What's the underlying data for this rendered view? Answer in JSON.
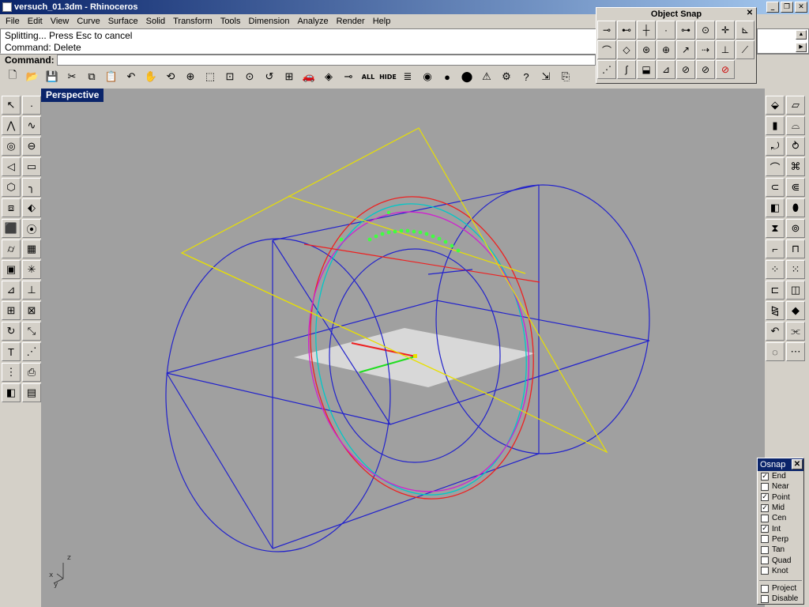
{
  "window": {
    "title": "versuch_01.3dm - Rhinoceros",
    "buttons": {
      "minimize": "_",
      "restore": "❐",
      "close": "✕"
    }
  },
  "menu": [
    "File",
    "Edit",
    "View",
    "Curve",
    "Surface",
    "Solid",
    "Transform",
    "Tools",
    "Dimension",
    "Analyze",
    "Render",
    "Help"
  ],
  "command_history": [
    "Splitting... Press Esc to cancel",
    "Command: Delete"
  ],
  "command_prompt": "Command:",
  "main_toolbar": [
    {
      "name": "new-icon",
      "glyph": "🗋"
    },
    {
      "name": "open-icon",
      "glyph": "📂"
    },
    {
      "name": "save-icon",
      "glyph": "💾"
    },
    {
      "name": "cut-icon",
      "glyph": "✂"
    },
    {
      "name": "copy-icon",
      "glyph": "⧉"
    },
    {
      "name": "paste-icon",
      "glyph": "📋"
    },
    {
      "name": "undo-icon",
      "glyph": "↶"
    },
    {
      "name": "pan-icon",
      "glyph": "✋"
    },
    {
      "name": "rotate-view-icon",
      "glyph": "⟲"
    },
    {
      "name": "zoom-icon",
      "glyph": "⊕"
    },
    {
      "name": "zoom-window-icon",
      "glyph": "⬚"
    },
    {
      "name": "zoom-extents-icon",
      "glyph": "⊡"
    },
    {
      "name": "zoom-selected-icon",
      "glyph": "⊙"
    },
    {
      "name": "undo-view-icon",
      "glyph": "↺"
    },
    {
      "name": "four-views-icon",
      "glyph": "⊞"
    },
    {
      "name": "car-icon",
      "glyph": "🚗"
    },
    {
      "name": "hide-icon",
      "glyph": "◈"
    },
    {
      "name": "point-toggle-icon",
      "glyph": "⊸"
    },
    {
      "name": "show-all-icon",
      "text": "ALL"
    },
    {
      "name": "hide-text-icon",
      "text": "HIDE"
    },
    {
      "name": "layers-icon",
      "glyph": "≣"
    },
    {
      "name": "color-wheel-icon",
      "glyph": "◉"
    },
    {
      "name": "shade-icon",
      "glyph": "●"
    },
    {
      "name": "render-icon",
      "glyph": "⬤"
    },
    {
      "name": "light-icon",
      "glyph": "⚠"
    },
    {
      "name": "settings-icon",
      "glyph": "⚙"
    },
    {
      "name": "help-icon",
      "glyph": "?"
    },
    {
      "name": "dimension-icon",
      "glyph": "⇲"
    },
    {
      "name": "properties-icon",
      "glyph": "⎘"
    }
  ],
  "left_toolbar": [
    {
      "name": "select-icon",
      "glyph": "↖"
    },
    {
      "name": "point-icon",
      "glyph": "·"
    },
    {
      "name": "polyline-icon",
      "glyph": "⋀"
    },
    {
      "name": "curve-icon",
      "glyph": "∿"
    },
    {
      "name": "circle-icon",
      "glyph": "◎"
    },
    {
      "name": "ellipse-icon",
      "glyph": "⊖"
    },
    {
      "name": "arc-icon",
      "glyph": "◁"
    },
    {
      "name": "rectangle-icon",
      "glyph": "▭"
    },
    {
      "name": "polygon-icon",
      "glyph": "⬡"
    },
    {
      "name": "fillet-icon",
      "glyph": "╮"
    },
    {
      "name": "surface-points-icon",
      "glyph": "⧈"
    },
    {
      "name": "surface-icon",
      "glyph": "⬖"
    },
    {
      "name": "box-icon",
      "glyph": "⬛"
    },
    {
      "name": "boolean-icon",
      "glyph": "⦿"
    },
    {
      "name": "cylinder-icon",
      "glyph": "⌭"
    },
    {
      "name": "mesh-icon",
      "glyph": "▦"
    },
    {
      "name": "group-icon",
      "glyph": "▣"
    },
    {
      "name": "explode-icon",
      "glyph": "✳"
    },
    {
      "name": "split-icon",
      "glyph": "⊿"
    },
    {
      "name": "trim-icon",
      "glyph": "⊥"
    },
    {
      "name": "move-icon",
      "glyph": "⊞"
    },
    {
      "name": "array-icon",
      "glyph": "⊠"
    },
    {
      "name": "rotate-icon",
      "glyph": "↻"
    },
    {
      "name": "scale-icon",
      "glyph": "⤡"
    },
    {
      "name": "text-icon",
      "glyph": "T"
    },
    {
      "name": "dim-icon",
      "glyph": "⋰"
    },
    {
      "name": "grid-icon",
      "glyph": "⋮"
    },
    {
      "name": "sheet-icon",
      "glyph": "⎙"
    },
    {
      "name": "render-view-icon",
      "glyph": "◧"
    },
    {
      "name": "toolbar-icon",
      "glyph": "▤"
    }
  ],
  "right_toolbar": [
    {
      "name": "surface-edge-icon",
      "glyph": "⬙"
    },
    {
      "name": "surface-patch-icon",
      "glyph": "▱"
    },
    {
      "name": "extrude-icon",
      "glyph": "▮"
    },
    {
      "name": "loft-icon",
      "glyph": "⌓"
    },
    {
      "name": "revolve-icon",
      "glyph": "⤾"
    },
    {
      "name": "sweep-icon",
      "glyph": "⥁"
    },
    {
      "name": "blend-icon",
      "glyph": "⌒"
    },
    {
      "name": "network-icon",
      "glyph": "⌘"
    },
    {
      "name": "pipe-icon",
      "glyph": "⊂"
    },
    {
      "name": "rail-icon",
      "glyph": "⋐"
    },
    {
      "name": "solid-box-icon",
      "glyph": "◧"
    },
    {
      "name": "solid-cyl-icon",
      "glyph": "⬮"
    },
    {
      "name": "cone-icon",
      "glyph": "⧗"
    },
    {
      "name": "torus-icon",
      "glyph": "⊚"
    },
    {
      "name": "corner-icon",
      "glyph": "⌐"
    },
    {
      "name": "cap-icon",
      "glyph": "⊓"
    },
    {
      "name": "control-points-icon",
      "glyph": "⁘"
    },
    {
      "name": "edit-points-icon",
      "glyph": "⁙"
    },
    {
      "name": "shell-icon",
      "glyph": "⊏"
    },
    {
      "name": "offset-icon",
      "glyph": "◫"
    },
    {
      "name": "mirror-icon",
      "glyph": "⧎"
    },
    {
      "name": "diamond-icon",
      "glyph": "◆"
    },
    {
      "name": "undo-surface-icon",
      "glyph": "↶"
    },
    {
      "name": "match-icon",
      "glyph": "⫘"
    },
    {
      "name": "mesh-display-icon",
      "glyph": "◌"
    },
    {
      "name": "points-display-icon",
      "glyph": "⋯"
    }
  ],
  "viewport": {
    "label": "Perspective",
    "axes": {
      "x": "x",
      "y": "y",
      "z": "z"
    }
  },
  "object_snap_toolbar": {
    "title": "Object Snap",
    "close": "✕",
    "buttons": [
      {
        "name": "snap-end-icon",
        "glyph": "⊸"
      },
      {
        "name": "snap-near-icon",
        "glyph": "⊷"
      },
      {
        "name": "snap-point-icon",
        "glyph": "┼"
      },
      {
        "name": "snap-dot-icon",
        "glyph": "·"
      },
      {
        "name": "snap-mid-icon",
        "glyph": "⊶"
      },
      {
        "name": "snap-center-icon",
        "glyph": "⊙"
      },
      {
        "name": "snap-int-icon",
        "glyph": "✛"
      },
      {
        "name": "snap-perp-icon",
        "glyph": "⊾"
      },
      {
        "name": "snap-tan-icon",
        "glyph": "⌒"
      },
      {
        "name": "snap-quad-icon",
        "glyph": "◇"
      },
      {
        "name": "snap-knot-icon",
        "glyph": "⊛"
      },
      {
        "name": "snap-target-icon",
        "glyph": "⊕"
      },
      {
        "name": "snap-vector-icon",
        "glyph": "↗"
      },
      {
        "name": "snap-track-icon",
        "glyph": "⇢"
      },
      {
        "name": "snap-ortho-icon",
        "glyph": "⊥"
      },
      {
        "name": "snap-line-icon",
        "glyph": "⟋"
      },
      {
        "name": "snap-dots-icon",
        "glyph": "⋰"
      },
      {
        "name": "snap-curve-icon",
        "glyph": "∫"
      },
      {
        "name": "snap-surface-icon",
        "glyph": "⬓"
      },
      {
        "name": "snap-axis-icon",
        "glyph": "⊿"
      },
      {
        "name": "snap-disable1-icon",
        "glyph": "⊘"
      },
      {
        "name": "snap-disable2-icon",
        "glyph": "⊘"
      },
      {
        "name": "snap-disable3-icon",
        "glyph": "⊘",
        "red": true
      }
    ]
  },
  "osnap_panel": {
    "title": "Osnap",
    "close": "✕",
    "options": [
      {
        "label": "End",
        "checked": true
      },
      {
        "label": "Near",
        "checked": false
      },
      {
        "label": "Point",
        "checked": true
      },
      {
        "label": "Mid",
        "checked": true
      },
      {
        "label": "Cen",
        "checked": false
      },
      {
        "label": "Int",
        "checked": true
      },
      {
        "label": "Perp",
        "checked": false
      },
      {
        "label": "Tan",
        "checked": false
      },
      {
        "label": "Quad",
        "checked": false
      },
      {
        "label": "Knot",
        "checked": false
      }
    ],
    "extra": [
      {
        "label": "Project",
        "checked": false
      },
      {
        "label": "Disable",
        "checked": false
      }
    ]
  },
  "colors": {
    "blue_geometry": "#2222cc",
    "yellow_plane": "#e8e000",
    "red_circle": "#ee2020",
    "cyan_circle": "#00c8c8",
    "magenta_circle": "#d020d0",
    "viewport_bg": "#a0a0a0",
    "cplane": "#d8d8d8"
  }
}
